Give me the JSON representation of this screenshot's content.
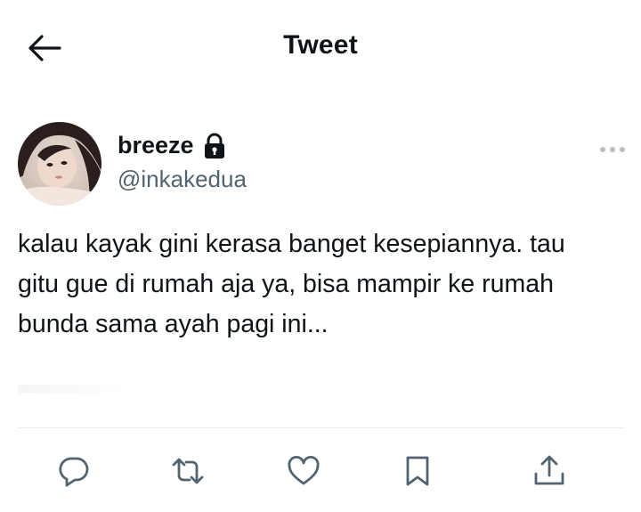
{
  "header": {
    "title": "Tweet",
    "back_icon": "arrow-left-icon"
  },
  "author": {
    "name": "breeze",
    "handle": "@inkakedua",
    "protected_icon": "lock-icon",
    "avatar": "profile-photo"
  },
  "tweet": {
    "lines": [
      "kalau kayak gini kerasa banget kesepiannya. tau",
      "gitu gue di rumah aja ya, bisa mampir ke rumah",
      "bunda sama ayah pagi ini..."
    ]
  },
  "actions": [
    {
      "name": "reply",
      "icon": "reply-icon"
    },
    {
      "name": "retweet",
      "icon": "retweet-icon"
    },
    {
      "name": "like",
      "icon": "heart-icon"
    },
    {
      "name": "bookmark",
      "icon": "bookmark-icon"
    },
    {
      "name": "share",
      "icon": "share-icon"
    }
  ],
  "colors": {
    "text_primary": "#0f1419",
    "text_secondary": "#536471",
    "divider": "#e6ecf0",
    "icon": "#536471"
  }
}
